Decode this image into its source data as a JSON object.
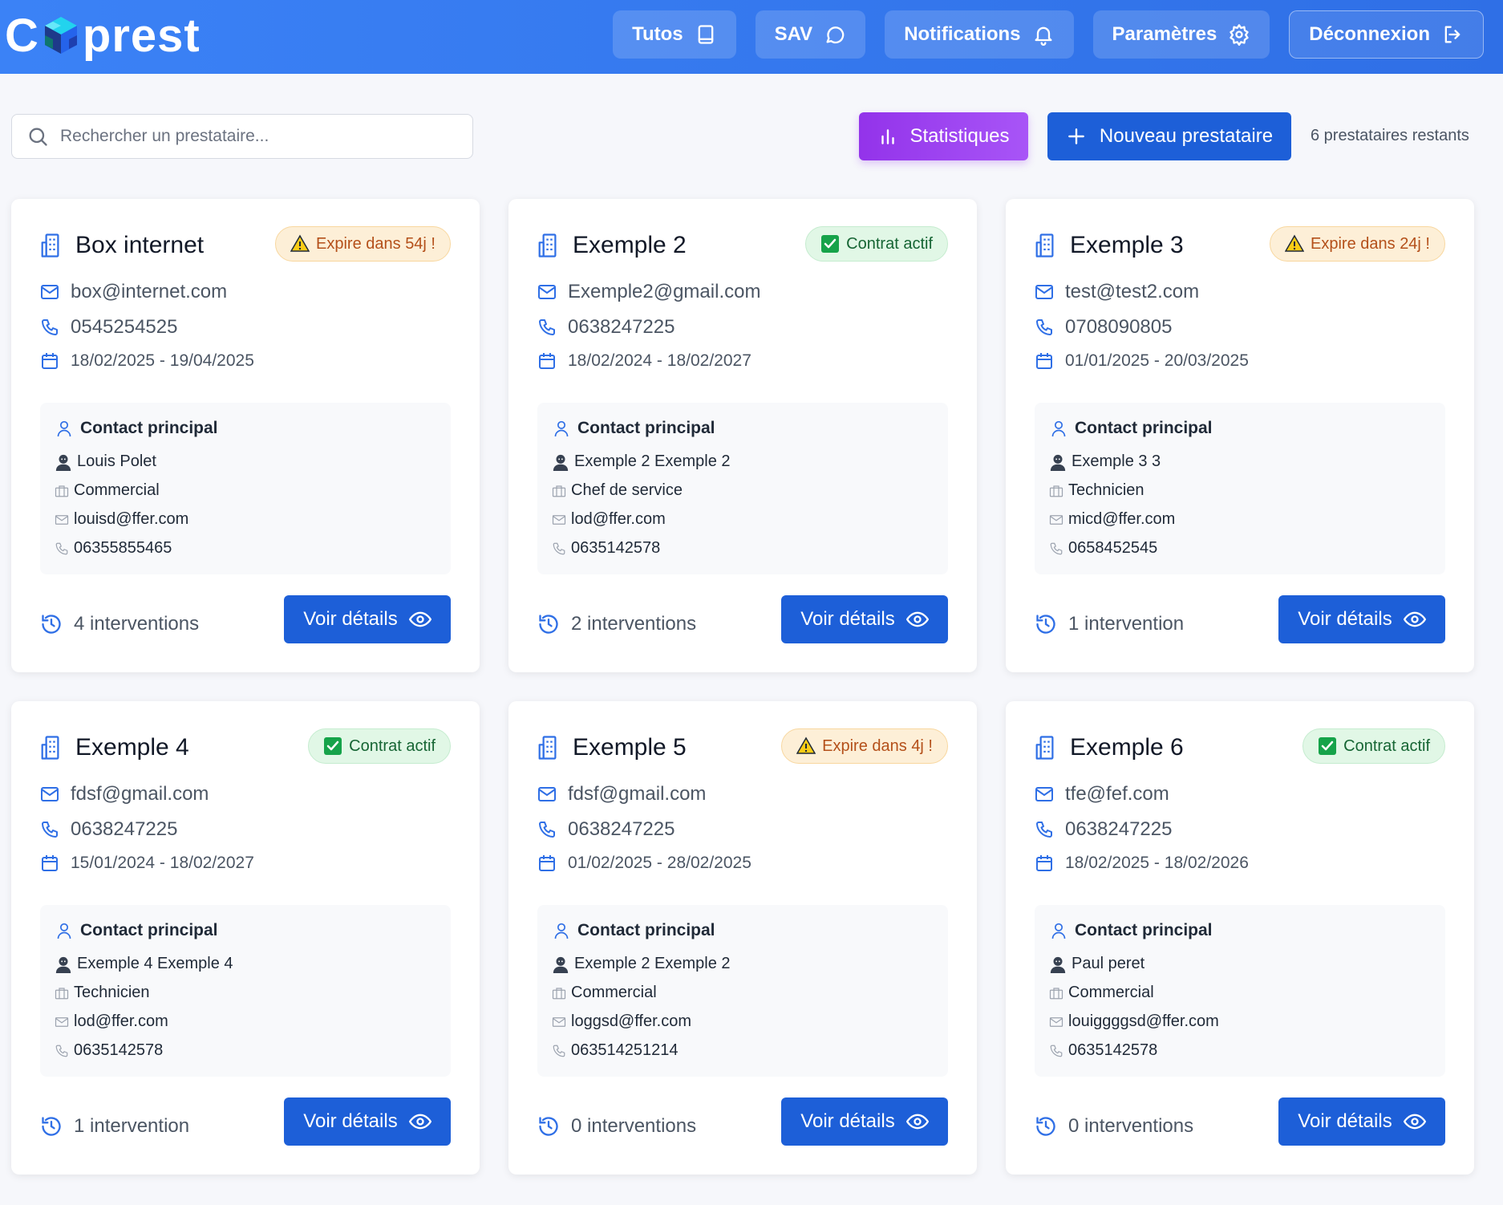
{
  "header": {
    "logo_left": "C",
    "logo_right": "prest",
    "nav": [
      {
        "label": "Tutos",
        "icon": "book-icon"
      },
      {
        "label": "SAV",
        "icon": "chat-bubble-icon"
      },
      {
        "label": "Notifications",
        "icon": "bell-icon"
      },
      {
        "label": "Paramètres",
        "icon": "gear-icon"
      },
      {
        "label": "Déconnexion",
        "icon": "logout-icon"
      }
    ]
  },
  "toolbar": {
    "search_placeholder": "Rechercher un prestataire...",
    "stats_label": "Statistiques",
    "new_label": "Nouveau prestataire",
    "remaining": "6 prestataires restants"
  },
  "labels": {
    "contact_heading": "Contact principal",
    "details_button": "Voir détails"
  },
  "colors": {
    "header": "#2f6fe6",
    "primary_button": "#1d5fd8",
    "stats_button": "#9333ea",
    "warn_badge_bg": "#fdefd7",
    "ok_badge_bg": "#e1f7e6"
  },
  "cards": [
    {
      "name": "Box internet",
      "status": {
        "type": "warn",
        "text": "Expire dans 54j !"
      },
      "email": "box@internet.com",
      "phone": "0545254525",
      "dates": "18/02/2025 - 19/04/2025",
      "contact": {
        "name": "Louis Polet",
        "role": "Commercial",
        "email": "louisd@ffer.com",
        "phone": "06355855465"
      },
      "interventions": "4 interventions"
    },
    {
      "name": "Exemple 2",
      "status": {
        "type": "ok",
        "text": "Contrat actif"
      },
      "email": "Exemple2@gmail.com",
      "phone": "0638247225",
      "dates": "18/02/2024 - 18/02/2027",
      "contact": {
        "name": "Exemple 2 Exemple 2",
        "role": "Chef de service",
        "email": "lod@ffer.com",
        "phone": "0635142578"
      },
      "interventions": "2 interventions"
    },
    {
      "name": "Exemple 3",
      "status": {
        "type": "warn",
        "text": "Expire dans 24j !"
      },
      "email": "test@test2.com",
      "phone": "0708090805",
      "dates": "01/01/2025 - 20/03/2025",
      "contact": {
        "name": "Exemple 3 3",
        "role": "Technicien",
        "email": "micd@ffer.com",
        "phone": "0658452545"
      },
      "interventions": "1 intervention"
    },
    {
      "name": "Exemple 4",
      "status": {
        "type": "ok",
        "text": "Contrat actif"
      },
      "email": "fdsf@gmail.com",
      "phone": "0638247225",
      "dates": "15/01/2024 - 18/02/2027",
      "contact": {
        "name": "Exemple 4 Exemple 4",
        "role": "Technicien",
        "email": "lod@ffer.com",
        "phone": "0635142578"
      },
      "interventions": "1 intervention"
    },
    {
      "name": "Exemple 5",
      "status": {
        "type": "warn",
        "text": "Expire dans 4j !"
      },
      "email": "fdsf@gmail.com",
      "phone": "0638247225",
      "dates": "01/02/2025 - 28/02/2025",
      "contact": {
        "name": "Exemple 2 Exemple 2",
        "role": "Commercial",
        "email": "loggsd@ffer.com",
        "phone": "063514251214"
      },
      "interventions": "0 interventions"
    },
    {
      "name": "Exemple 6",
      "status": {
        "type": "ok",
        "text": "Contrat actif"
      },
      "email": "tfe@fef.com",
      "phone": "0638247225",
      "dates": "18/02/2025 - 18/02/2026",
      "contact": {
        "name": "Paul peret",
        "role": "Commercial",
        "email": "louiggggsd@ffer.com",
        "phone": "0635142578"
      },
      "interventions": "0 interventions"
    }
  ]
}
